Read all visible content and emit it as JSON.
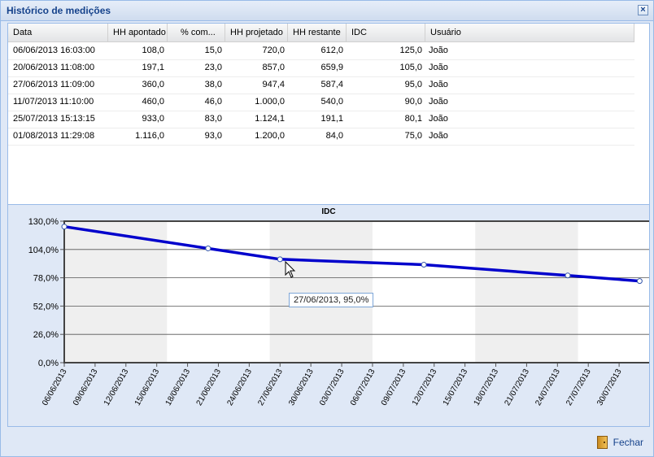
{
  "window": {
    "title": "Histórico de medições",
    "close_icon": "close-icon"
  },
  "grid": {
    "columns": [
      "Data",
      "HH apontado",
      "% com...",
      "HH projetado",
      "HH restante",
      "IDC",
      "Usuário"
    ],
    "rows": [
      [
        "06/06/2013 16:03:00",
        "108,0",
        "15,0",
        "720,0",
        "612,0",
        "125,0",
        "João"
      ],
      [
        "20/06/2013 11:08:00",
        "197,1",
        "23,0",
        "857,0",
        "659,9",
        "105,0",
        "João"
      ],
      [
        "27/06/2013 11:09:00",
        "360,0",
        "38,0",
        "947,4",
        "587,4",
        "95,0",
        "João"
      ],
      [
        "11/07/2013 11:10:00",
        "460,0",
        "46,0",
        "1.000,0",
        "540,0",
        "90,0",
        "João"
      ],
      [
        "25/07/2013 15:13:15",
        "933,0",
        "83,0",
        "1.124,1",
        "191,1",
        "80,1",
        "João"
      ],
      [
        "01/08/2013 11:29:08",
        "1.116,0",
        "93,0",
        "1.200,0",
        "84,0",
        "75,0",
        "João"
      ]
    ]
  },
  "chart_data": {
    "type": "line",
    "title": "IDC",
    "series": [
      {
        "values": [
          {
            "x": "06/06/2013",
            "y": 125.0
          },
          {
            "x": "20/06/2013",
            "y": 105.0
          },
          {
            "x": "27/06/2013",
            "y": 95.0
          },
          {
            "x": "11/07/2013",
            "y": 90.0
          },
          {
            "x": "25/07/2013",
            "y": 80.1
          },
          {
            "x": "01/08/2013",
            "y": 75.0
          }
        ],
        "color": "#0000cc"
      }
    ],
    "y_ticks": [
      "0,0%",
      "26,0%",
      "52,0%",
      "78,0%",
      "104,0%",
      "130,0%"
    ],
    "ylim": [
      0,
      130
    ],
    "x_ticks": [
      "06/06/2013",
      "09/06/2013",
      "12/06/2013",
      "15/06/2013",
      "18/06/2013",
      "21/06/2013",
      "24/06/2013",
      "27/06/2013",
      "30/06/2013",
      "03/07/2013",
      "06/07/2013",
      "09/07/2013",
      "12/07/2013",
      "15/07/2013",
      "18/07/2013",
      "21/07/2013",
      "24/07/2013",
      "27/07/2013",
      "30/07/2013"
    ],
    "xlim": [
      "06/06/2013",
      "02/08/2013"
    ],
    "grid": true,
    "tooltip": "27/06/2013, 95,0%"
  },
  "footer": {
    "close_label": "Fechar",
    "close_icon": "door-icon"
  }
}
